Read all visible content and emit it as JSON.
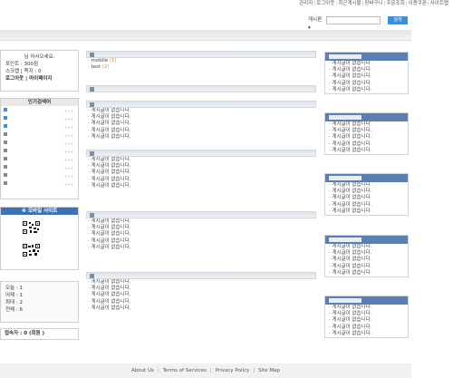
{
  "top_menu": [
    "관리자",
    "로그아웃",
    "최근게시물",
    "장바구니",
    "주문조회",
    "이용쿠폰",
    "사이트맵"
  ],
  "search": {
    "select_label": "게시판 ▾",
    "button": "검색"
  },
  "login": {
    "greeting": "님 어서오세요.",
    "point": "포인트 : 300점",
    "scrap": "스크랩 | 쪽지 : 0",
    "links": "로그아웃 | 마이페이지"
  },
  "popular": {
    "title": "인기검색어",
    "dots": "+++",
    "rank_color": "#3b8ee0",
    "items": [
      1,
      2,
      3,
      4,
      5,
      6,
      7,
      8,
      9,
      10
    ]
  },
  "mobile": {
    "title": "※ 모바일 사이트"
  },
  "visitors": {
    "today": "오늘 : 1",
    "yesterday": "어제 : 1",
    "max": "최대 : 2",
    "total": "전체 : 6"
  },
  "online": "접속자 : 0 (회원 )",
  "middle": {
    "first": {
      "items": [
        {
          "name": "· mobile",
          "count": "(1)"
        },
        {
          "name": "· test",
          "count": "(2)"
        }
      ]
    },
    "empty_text": "· 게시글이 없습니다.",
    "boxes": 6
  },
  "right": {
    "empty_text": "· 게시글이 없습니다.",
    "boxes": 5
  },
  "footer": [
    "About Us",
    "Terms of Services",
    "Privacy Policy",
    "Site Map"
  ]
}
